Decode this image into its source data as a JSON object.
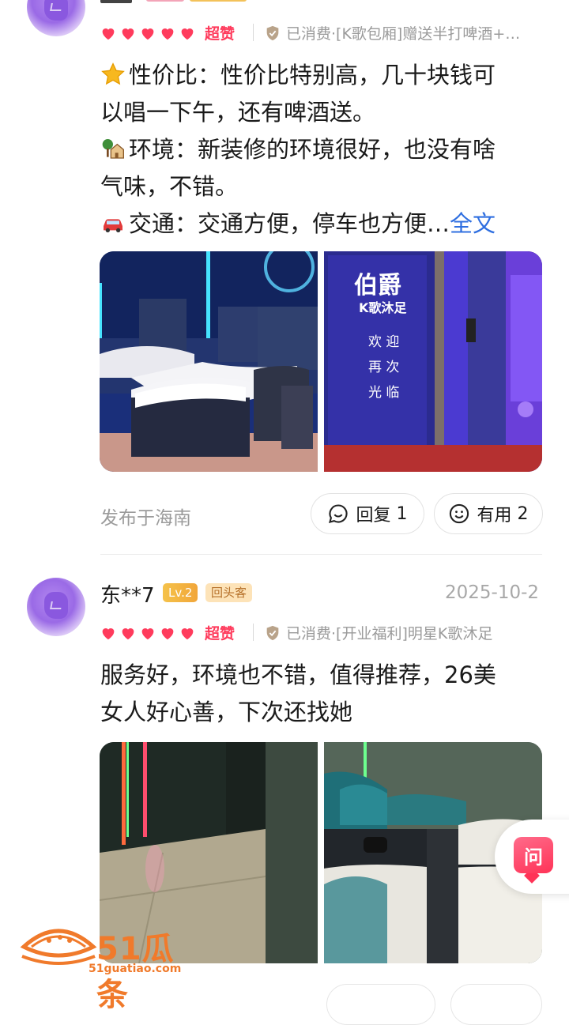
{
  "review1": {
    "rating_label": "超赞",
    "consume_text": "已消费·[K歌包厢]赠送半打啤酒+…",
    "lines": [
      {
        "icon": "star-icon",
        "text": "性价比：性价比特别高，几十块钱可"
      },
      {
        "icon": "",
        "text": "以唱一下午，还有啤酒送。"
      },
      {
        "icon": "house-tree-icon",
        "text": "环境：新装修的环境很好，也没有啥"
      },
      {
        "icon": "",
        "text": "气味，不错。"
      },
      {
        "icon": "car-icon",
        "text": "交通：交通方便，停车也方便…"
      }
    ],
    "full_text_link": "全文",
    "photo1_caption": "",
    "photo2_sign_title": "伯爵",
    "photo2_sign_sub": "K歌沐足",
    "photo2_sign_lines": [
      "欢 迎",
      "再 次",
      "光 临"
    ],
    "location": "发布于海南",
    "reply_label": "回复",
    "reply_count": "1",
    "useful_label": "有用",
    "useful_count": "2"
  },
  "review2": {
    "username": "东**7",
    "level": "Lv.2",
    "badge": "回头客",
    "date": "2025-10-2",
    "rating_label": "超赞",
    "consume_text": "已消费·[开业福利]明星K歌沐足",
    "lines": [
      "服务好，环境也不错，值得推荐，26美",
      "女人好心善，下次还找她"
    ]
  },
  "ask_button": "问",
  "watermark": {
    "brand": "51瓜条",
    "url": "51guatiao.com"
  },
  "colors": {
    "accent_red": "#ff3b5c",
    "link_blue": "#2f6fe0",
    "level_gold": "#f3b443"
  }
}
